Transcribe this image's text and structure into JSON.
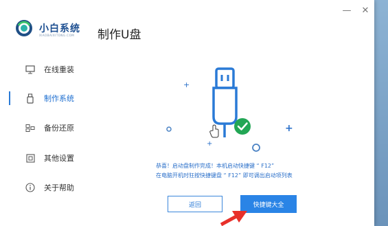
{
  "app": {
    "brand": "小白系统",
    "brand_sub": "XIAOBAIXITONG.COM",
    "title": "制作U盘"
  },
  "window_controls": {
    "minimize": "—",
    "close": "✕"
  },
  "sidebar": {
    "items": [
      {
        "label": "在线重装",
        "icon": "monitor-icon",
        "active": false
      },
      {
        "label": "制作系统",
        "icon": "usb-drive-icon",
        "active": true
      },
      {
        "label": "备份还原",
        "icon": "backup-icon",
        "active": false
      },
      {
        "label": "其他设置",
        "icon": "settings-box-icon",
        "active": false
      },
      {
        "label": "关于帮助",
        "icon": "info-icon",
        "active": false
      }
    ]
  },
  "main": {
    "message_line1": "恭喜！启动盘制作完成！本机启动快捷键 “ F12”",
    "message_line2": "在电脑开机时狂按快捷键盘 “ F12” 即可调出启动项列表",
    "back_button": "返回",
    "shortcut_button": "快捷键大全"
  },
  "colors": {
    "accent": "#2a84e6",
    "brand": "#1d4f91",
    "success": "#22a655",
    "arrow": "#e8302a"
  }
}
